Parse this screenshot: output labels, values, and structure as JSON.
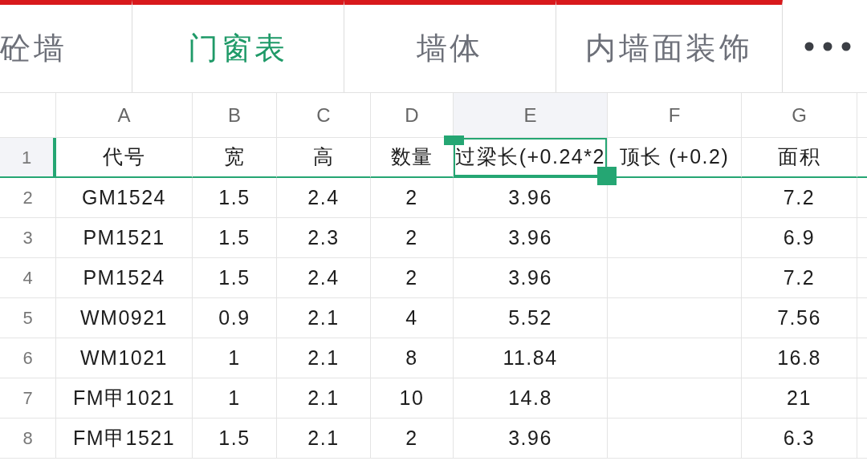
{
  "sheet_tabs": [
    {
      "label": "砼墙",
      "selected": false
    },
    {
      "label": "门窗表",
      "selected": true
    },
    {
      "label": "墙体",
      "selected": false
    },
    {
      "label": "内墙面装饰",
      "selected": false
    }
  ],
  "columns": [
    {
      "label": "A",
      "selected": false
    },
    {
      "label": "B",
      "selected": false
    },
    {
      "label": "C",
      "selected": false
    },
    {
      "label": "D",
      "selected": false
    },
    {
      "label": "E",
      "selected": true
    },
    {
      "label": "F",
      "selected": false
    },
    {
      "label": "G",
      "selected": false
    }
  ],
  "rows": [
    {
      "number": "1",
      "selected": true,
      "frozen": true,
      "cells": [
        "代号",
        "宽",
        "高",
        "数量",
        "过梁长(+0.24*2",
        "顶长 (+0.2)",
        "面积"
      ]
    },
    {
      "number": "2",
      "selected": false,
      "frozen": false,
      "cells": [
        "GM1524",
        "1.5",
        "2.4",
        "2",
        "3.96",
        null,
        "7.2"
      ]
    },
    {
      "number": "3",
      "selected": false,
      "frozen": false,
      "cells": [
        "PM1521",
        "1.5",
        "2.3",
        "2",
        "3.96",
        null,
        "6.9"
      ]
    },
    {
      "number": "4",
      "selected": false,
      "frozen": false,
      "cells": [
        "PM1524",
        "1.5",
        "2.4",
        "2",
        "3.96",
        null,
        "7.2"
      ]
    },
    {
      "number": "5",
      "selected": false,
      "frozen": false,
      "cells": [
        "WM0921",
        "0.9",
        "2.1",
        "4",
        "5.52",
        null,
        "7.56"
      ]
    },
    {
      "number": "6",
      "selected": false,
      "frozen": false,
      "cells": [
        "WM1021",
        "1",
        "2.1",
        "8",
        "11.84",
        null,
        "16.8"
      ]
    },
    {
      "number": "7",
      "selected": false,
      "frozen": false,
      "cells": [
        "FM甲1021",
        "1",
        "2.1",
        "10",
        "14.8",
        null,
        "21"
      ]
    },
    {
      "number": "8",
      "selected": false,
      "frozen": false,
      "cells": [
        "FM甲1521",
        "1.5",
        "2.1",
        "2",
        "3.96",
        null,
        "6.3"
      ]
    }
  ]
}
